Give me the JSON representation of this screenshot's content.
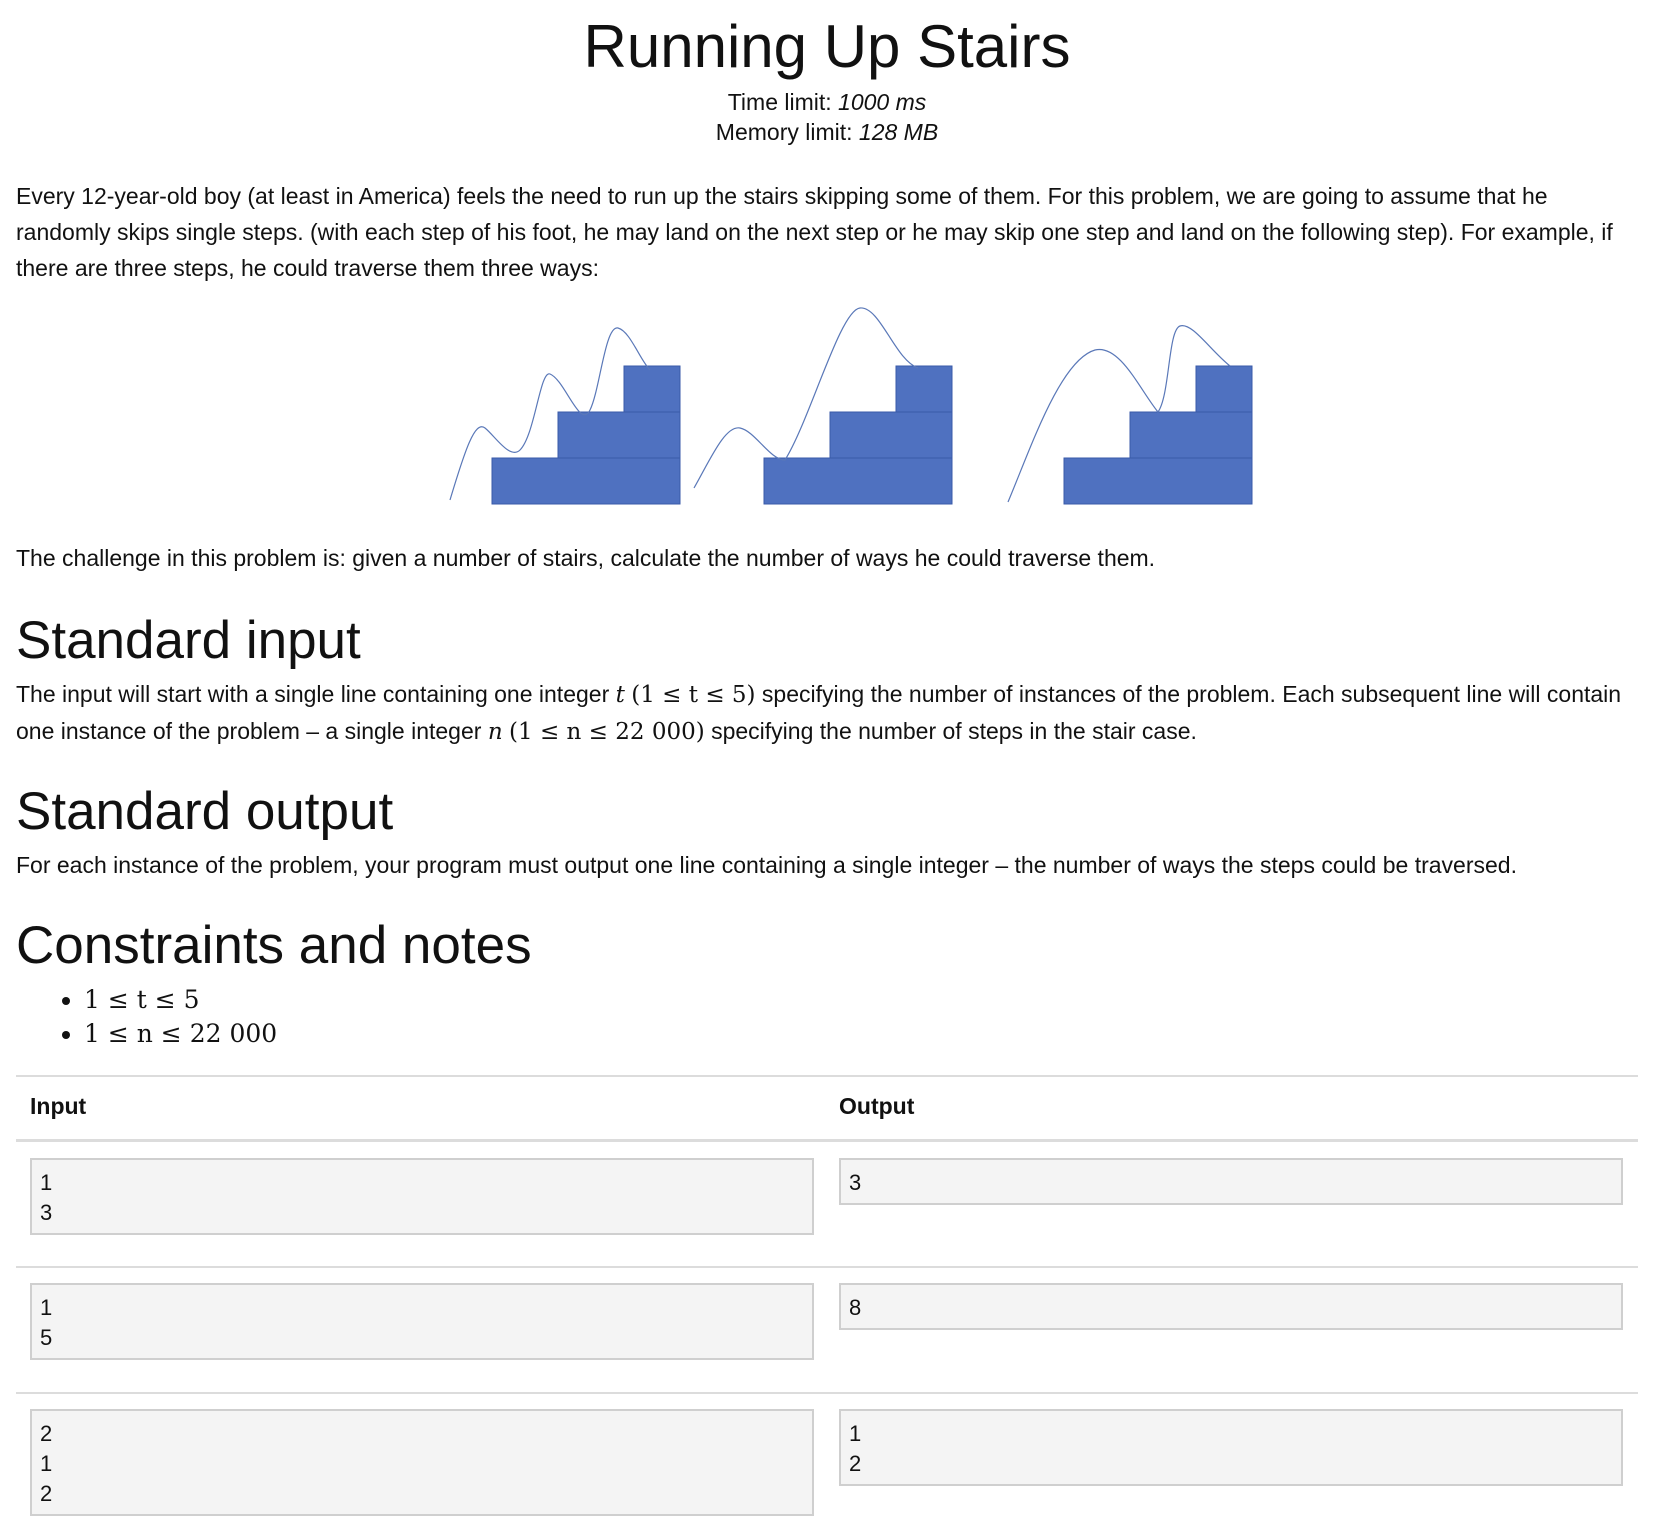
{
  "title": "Running Up Stairs",
  "limits": {
    "time_label": "Time limit:",
    "time_value": "1000 ms",
    "memory_label": "Memory limit:",
    "memory_value": "128 MB"
  },
  "intro": "Every 12-year-old boy (at least in America) feels the need to run up the stairs skipping some of them. For this problem, we are going to assume that he randomly skips single steps. (with each step of his foot, he may land on the next step or he may skip one step and land on the following step). For example, if there are three steps, he could traverse them three ways:",
  "challenge": "The challenge in this problem is: given a number of stairs, calculate the number of ways he could traverse them.",
  "input_section": {
    "heading": "Standard input",
    "text_1": "The input will start with a single line containing one integer",
    "var_t": "t",
    "range_t": "(1 ≤ t ≤ 5)",
    "text_2": "specifying the number of instances of the problem. Each subsequent line will contain one instance of the problem – a single integer",
    "var_n": "n",
    "range_n": "(1 ≤ n ≤ 22 000)",
    "text_3": "specifying the number of steps in the stair case."
  },
  "output_section": {
    "heading": "Standard output",
    "text": "For each instance of the problem, your program must output one line containing a single integer – the number of ways the steps could be traversed."
  },
  "constraints": {
    "heading": "Constraints and notes",
    "items": [
      "1 ≤ t ≤ 5",
      "1 ≤ n ≤ 22 000"
    ]
  },
  "samples": {
    "input_header": "Input",
    "output_header": "Output",
    "rows": [
      {
        "input": "1\n3",
        "output": "3"
      },
      {
        "input": "1\n5",
        "output": "8"
      },
      {
        "input": "2\n1\n2",
        "output": "1\n2"
      }
    ]
  },
  "colors": {
    "stair_fill": "#4f71c0",
    "stair_stroke": "#3a5aa8",
    "path_stroke": "#5a78b8"
  }
}
